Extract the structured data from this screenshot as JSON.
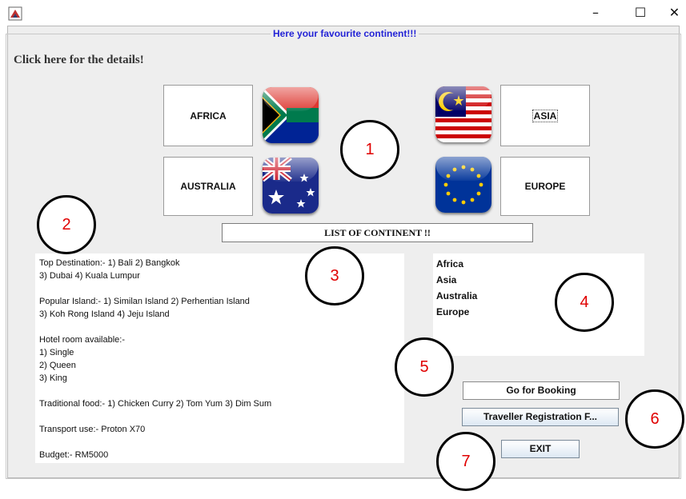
{
  "window": {
    "minimize_glyph": "–",
    "maximize_glyph": "☐",
    "close_glyph": "✕"
  },
  "panel": {
    "border_title": "Here your favourite continent!!!",
    "click_label": "Click here for the details!"
  },
  "continents": {
    "africa": "AFRICA",
    "australia": "AUSTRALIA",
    "asia": "ASIA",
    "europe": "EUROPE"
  },
  "flags": {
    "africa": "south-africa-flag-icon",
    "australia": "australia-flag-icon",
    "asia": "malaysia-flag-icon",
    "europe": "european-union-flag-icon"
  },
  "list_title": "LIST OF CONTINENT !!",
  "details_text": "Top Destination:- 1) Bali 2) Bangkok\n3) Dubai 4) Kuala Lumpur\n\nPopular Island:- 1) Similan Island 2) Perhentian Island\n3) Koh Rong Island 4) Jeju Island\n\nHotel room available:-\n1) Single\n2) Queen\n3) King\n\nTraditional food:- 1) Chicken Curry 2) Tom Yum 3) Dim Sum\n\nTransport use:- Proton X70\n\nBudget:- RM5000",
  "continent_list": [
    "Africa",
    "Asia",
    "Australia",
    "Europe"
  ],
  "buttons": {
    "booking": "Go for Booking",
    "registration": "Traveller Registration F...",
    "exit": "EXIT"
  },
  "callouts": [
    "1",
    "2",
    "3",
    "4",
    "5",
    "6",
    "7"
  ],
  "colors": {
    "title_blue": "#2424d6",
    "callout_red": "#e00000"
  }
}
